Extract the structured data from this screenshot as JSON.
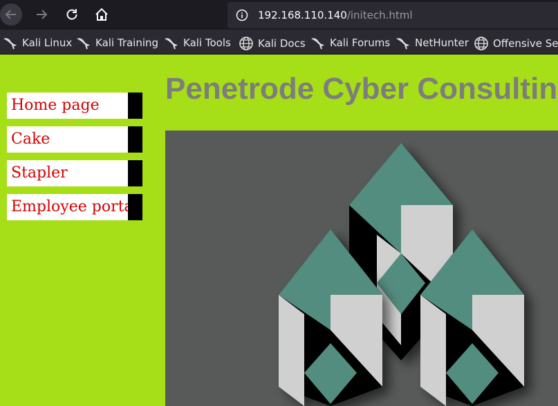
{
  "browser": {
    "url_host": "192.168.110.140",
    "url_path": "/initech.html"
  },
  "bookmarks": [
    {
      "label": "Kali Linux",
      "icon": "kali-dragon-icon"
    },
    {
      "label": "Kali Training",
      "icon": "kali-dragon-icon"
    },
    {
      "label": "Kali Tools",
      "icon": "kali-dragon-icon"
    },
    {
      "label": "Kali Docs",
      "icon": "globe-icon"
    },
    {
      "label": "Kali Forums",
      "icon": "kali-dragon-icon"
    },
    {
      "label": "NetHunter",
      "icon": "kali-dragon-icon"
    },
    {
      "label": "Offensive Secu",
      "icon": "globe-icon"
    }
  ],
  "sidebar": {
    "items": [
      {
        "label": "Home page"
      },
      {
        "label": "Cake"
      },
      {
        "label": "Stapler"
      },
      {
        "label": "Employee portal"
      }
    ]
  },
  "page": {
    "title": "Penetrode Cyber Consulting"
  },
  "colors": {
    "page_background": "#a6de17",
    "link": "#d40000",
    "title": "#7d7d7d",
    "logo_teal": "#538d7f",
    "logo_light": "#d0d0d0"
  }
}
